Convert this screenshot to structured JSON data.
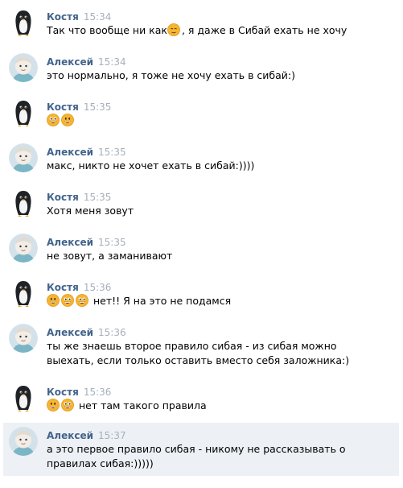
{
  "messages": [
    {
      "author": "Костя",
      "time": "15:34",
      "avatar": "penguin-avatar",
      "parts": [
        {
          "t": "Так что вообще ни как"
        },
        {
          "e": "relieved-emoji"
        },
        {
          "t": ", я даже в Сибай ехать не хочу"
        }
      ]
    },
    {
      "author": "Алексей",
      "time": "15:34",
      "avatar": "character-avatar",
      "parts": [
        {
          "t": "это нормально, я тоже не хочу ехать в сибай:)"
        }
      ]
    },
    {
      "author": "Костя",
      "time": "15:35",
      "avatar": "penguin-avatar",
      "parts": [
        {
          "e": "beaming-emoji"
        },
        {
          "e": "grin-emoji"
        }
      ]
    },
    {
      "author": "Алексей",
      "time": "15:35",
      "avatar": "character-avatar",
      "parts": [
        {
          "t": "макс, никто не хочет ехать в сибай:))))"
        }
      ]
    },
    {
      "author": "Костя",
      "time": "15:35",
      "avatar": "penguin-avatar",
      "parts": [
        {
          "t": "Хотя меня зовут"
        }
      ]
    },
    {
      "author": "Алексей",
      "time": "15:35",
      "avatar": "character-avatar",
      "parts": [
        {
          "t": "не зовут, а заманивают"
        }
      ]
    },
    {
      "author": "Костя",
      "time": "15:36",
      "avatar": "penguin-avatar",
      "parts": [
        {
          "e": "grin-emoji"
        },
        {
          "e": "beaming-emoji"
        },
        {
          "e": "beaming-emoji"
        },
        {
          "t": " нет!! Я на это не подамся"
        }
      ]
    },
    {
      "author": "Алексей",
      "time": "15:36",
      "avatar": "character-avatar",
      "lines": [
        "ты же знаешь второе правило сибая - из сибая можно",
        "выехать, если только оставить вместо себя заложника:)"
      ]
    },
    {
      "author": "Костя",
      "time": "15:36",
      "avatar": "penguin-avatar",
      "parts": [
        {
          "e": "grin-emoji"
        },
        {
          "e": "beaming-emoji"
        },
        {
          "t": " нет там такого правила"
        }
      ]
    },
    {
      "author": "Алексей",
      "time": "15:37",
      "avatar": "character-avatar",
      "highlighted": true,
      "lines": [
        "а это первое правило сибая - никому не рассказывать о",
        "правилах сибая:)))))"
      ]
    }
  ],
  "colors": {
    "author_name": "#42648b",
    "timestamp": "#a5b0bc",
    "highlight_bg": "#edf0f5",
    "emoji_face": "#f5b52e"
  }
}
